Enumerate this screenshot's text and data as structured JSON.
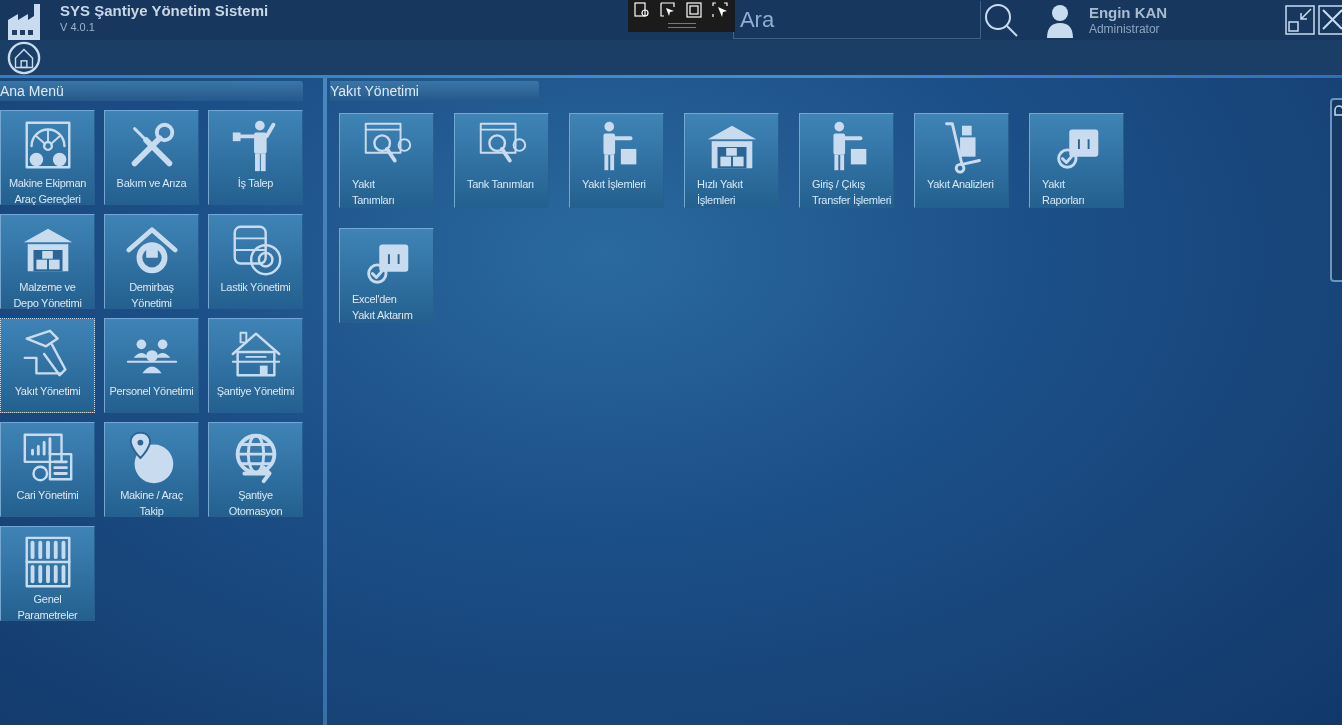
{
  "app": {
    "title": "SYS Şantiye Yönetim Sistemi",
    "version": "V 4.0.1"
  },
  "search": {
    "placeholder": "Ara"
  },
  "user": {
    "name": "Engin KAN",
    "role": "Administrator"
  },
  "main_menu": {
    "title": "Ana Menü",
    "items": [
      {
        "label": "Makine Ekipman\nAraç Gereçleri",
        "selected": false
      },
      {
        "label": "Bakım ve Arıza",
        "selected": false
      },
      {
        "label": "İş Talep",
        "selected": false
      },
      {
        "label": "Malzeme ve\nDepo Yönetimi",
        "selected": false
      },
      {
        "label": "Demirbaş\nYönetimi",
        "selected": false
      },
      {
        "label": "Lastik Yönetimi",
        "selected": false
      },
      {
        "label": "Yakıt Yönetimi",
        "selected": true
      },
      {
        "label": "Personel Yönetimi",
        "selected": false
      },
      {
        "label": "Şantiye Yönetimi",
        "selected": false
      },
      {
        "label": "Cari Yönetimi",
        "selected": false
      },
      {
        "label": "Makine / Araç\nTakip",
        "selected": false
      },
      {
        "label": "Şantiye\nOtomasyon",
        "selected": false
      },
      {
        "label": "Genel\nParametreler",
        "selected": false
      }
    ]
  },
  "submenu": {
    "title": "Yakıt Yönetimi",
    "items": [
      {
        "label": "Yakıt\nTanımları"
      },
      {
        "label": "Tank Tanımları"
      },
      {
        "label": "Yakıt İşlemleri"
      },
      {
        "label": "Hızlı Yakıt\nİşlemleri"
      },
      {
        "label": "Giriş / Çıkış\nTransfer İşlemleri"
      },
      {
        "label": "Yakıt Analizleri"
      },
      {
        "label": "Yakıt\nRaporları"
      },
      {
        "label": "Excel'den\nYakıt Aktarım"
      }
    ]
  }
}
